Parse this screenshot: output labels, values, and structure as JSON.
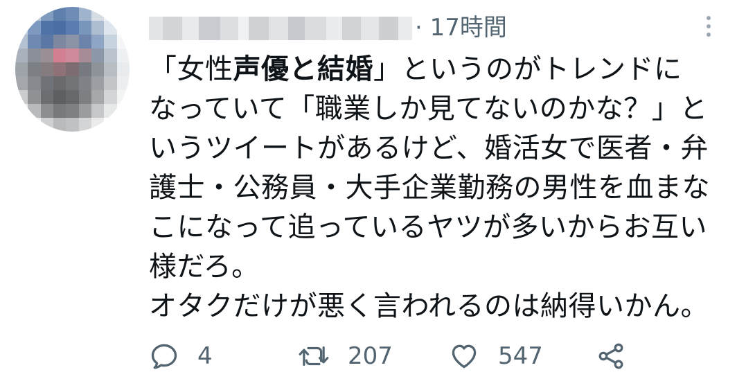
{
  "tweet": {
    "author": {
      "avatar_icon": "avatar-pixelated",
      "name_redacted": true
    },
    "time": "· 17時間",
    "menu_icon": "more-vertical-icon",
    "text_lines": [
      {
        "pre": "「女性",
        "bold": "声優と結婚",
        "post": "」というのがトレンドに"
      },
      {
        "pre": "なっていて「職業しか見てないのかな？」と",
        "bold": "",
        "post": ""
      },
      {
        "pre": "いうツイートがあるけど、婚活女で医者・弁",
        "bold": "",
        "post": ""
      },
      {
        "pre": "護士・公務員・大手企業勤務の男性を血まな",
        "bold": "",
        "post": ""
      },
      {
        "pre": "こになって追っているヤツが多いからお互い",
        "bold": "",
        "post": ""
      },
      {
        "pre": "様だろ。",
        "bold": "",
        "post": ""
      },
      {
        "pre": "オタクだけが悪く言われるのは納得いかん。",
        "bold": "",
        "post": ""
      }
    ],
    "actions": {
      "reply": {
        "icon": "reply-icon",
        "count": "4"
      },
      "retweet": {
        "icon": "retweet-icon",
        "count": "207"
      },
      "like": {
        "icon": "heart-icon",
        "count": "547"
      },
      "share": {
        "icon": "share-icon"
      }
    },
    "colors": {
      "text": "#0f1419",
      "secondary": "#536471"
    }
  }
}
